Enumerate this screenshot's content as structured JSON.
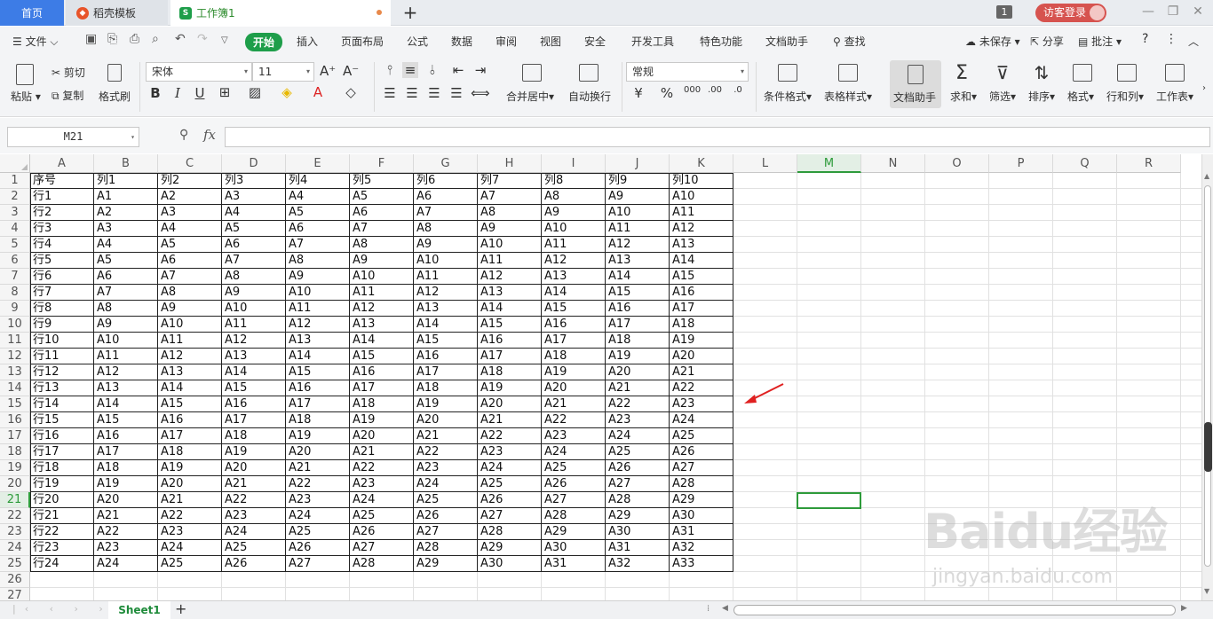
{
  "titlebar": {
    "tabs": [
      {
        "label": "首页"
      },
      {
        "label": "稻壳模板"
      },
      {
        "label": "工作簿1"
      }
    ],
    "new_tab": "+",
    "window_count": "1",
    "login": "访客登录"
  },
  "menubar": {
    "file": "文件",
    "items": [
      "开始",
      "插入",
      "页面布局",
      "公式",
      "数据",
      "审阅",
      "视图",
      "安全",
      "开发工具",
      "特色功能",
      "文档助手"
    ],
    "search": "查找",
    "unsaved": "未保存",
    "share": "分享",
    "comment": "批注"
  },
  "ribbon": {
    "paste": "粘贴",
    "cut": "剪切",
    "copy": "复制",
    "format_painter": "格式刷",
    "font": "宋体",
    "font_size": "11",
    "merge": "合并居中",
    "wrap": "自动换行",
    "number_format": "常规",
    "cond_format": "条件格式",
    "table_style": "表格样式",
    "doc_helper": "文档助手",
    "sum": "求和",
    "filter": "筛选",
    "sort": "排序",
    "format": "格式",
    "rowcol": "行和列",
    "worksheet": "工作表"
  },
  "formula_bar": {
    "name_box": "M21",
    "fx": "fx",
    "formula": ""
  },
  "sheet": {
    "columns": [
      "A",
      "B",
      "C",
      "D",
      "E",
      "F",
      "G",
      "H",
      "I",
      "J",
      "K",
      "L",
      "M",
      "N",
      "O",
      "P",
      "Q",
      "R"
    ],
    "selected_cell": "M21",
    "header_row": [
      "序号",
      "列1",
      "列2",
      "列3",
      "列4",
      "列5",
      "列6",
      "列7",
      "列8",
      "列9",
      "列10"
    ],
    "row_labels": [
      "行1",
      "行2",
      "行3",
      "行4",
      "行5",
      "行6",
      "行7",
      "行8",
      "行9",
      "行10",
      "行11",
      "行12",
      "行13",
      "行14",
      "行15",
      "行16",
      "行17",
      "行18",
      "行19",
      "行20",
      "行21",
      "行22",
      "行23",
      "行24"
    ],
    "row_numbers": [
      "1",
      "2",
      "3",
      "4",
      "5",
      "6",
      "7",
      "8",
      "9",
      "10",
      "11",
      "12",
      "13",
      "14",
      "15",
      "16",
      "17",
      "18",
      "19",
      "20",
      "21",
      "22",
      "23",
      "24",
      "25",
      "26",
      "27"
    ],
    "cells": [
      [
        "A1",
        "A2",
        "A3",
        "A4",
        "A5",
        "A6",
        "A7",
        "A8",
        "A9",
        "A10"
      ],
      [
        "A2",
        "A3",
        "A4",
        "A5",
        "A6",
        "A7",
        "A8",
        "A9",
        "A10",
        "A11"
      ],
      [
        "A3",
        "A4",
        "A5",
        "A6",
        "A7",
        "A8",
        "A9",
        "A10",
        "A11",
        "A12"
      ],
      [
        "A4",
        "A5",
        "A6",
        "A7",
        "A8",
        "A9",
        "A10",
        "A11",
        "A12",
        "A13"
      ],
      [
        "A5",
        "A6",
        "A7",
        "A8",
        "A9",
        "A10",
        "A11",
        "A12",
        "A13",
        "A14"
      ],
      [
        "A6",
        "A7",
        "A8",
        "A9",
        "A10",
        "A11",
        "A12",
        "A13",
        "A14",
        "A15"
      ],
      [
        "A7",
        "A8",
        "A9",
        "A10",
        "A11",
        "A12",
        "A13",
        "A14",
        "A15",
        "A16"
      ],
      [
        "A8",
        "A9",
        "A10",
        "A11",
        "A12",
        "A13",
        "A14",
        "A15",
        "A16",
        "A17"
      ],
      [
        "A9",
        "A10",
        "A11",
        "A12",
        "A13",
        "A14",
        "A15",
        "A16",
        "A17",
        "A18"
      ],
      [
        "A10",
        "A11",
        "A12",
        "A13",
        "A14",
        "A15",
        "A16",
        "A17",
        "A18",
        "A19"
      ],
      [
        "A11",
        "A12",
        "A13",
        "A14",
        "A15",
        "A16",
        "A17",
        "A18",
        "A19",
        "A20"
      ],
      [
        "A12",
        "A13",
        "A14",
        "A15",
        "A16",
        "A17",
        "A18",
        "A19",
        "A20",
        "A21"
      ],
      [
        "A13",
        "A14",
        "A15",
        "A16",
        "A17",
        "A18",
        "A19",
        "A20",
        "A21",
        "A22"
      ],
      [
        "A14",
        "A15",
        "A16",
        "A17",
        "A18",
        "A19",
        "A20",
        "A21",
        "A22",
        "A23"
      ],
      [
        "A15",
        "A16",
        "A17",
        "A18",
        "A19",
        "A20",
        "A21",
        "A22",
        "A23",
        "A24"
      ],
      [
        "A16",
        "A17",
        "A18",
        "A19",
        "A20",
        "A21",
        "A22",
        "A23",
        "A24",
        "A25"
      ],
      [
        "A17",
        "A18",
        "A19",
        "A20",
        "A21",
        "A22",
        "A23",
        "A24",
        "A25",
        "A26"
      ],
      [
        "A18",
        "A19",
        "A20",
        "A21",
        "A22",
        "A23",
        "A24",
        "A25",
        "A26",
        "A27"
      ],
      [
        "A19",
        "A20",
        "A21",
        "A22",
        "A23",
        "A24",
        "A25",
        "A26",
        "A27",
        "A28"
      ],
      [
        "A20",
        "A21",
        "A22",
        "A23",
        "A24",
        "A25",
        "A26",
        "A27",
        "A28",
        "A29"
      ],
      [
        "A21",
        "A22",
        "A23",
        "A24",
        "A25",
        "A26",
        "A27",
        "A28",
        "A29",
        "A30"
      ],
      [
        "A22",
        "A23",
        "A24",
        "A25",
        "A26",
        "A27",
        "A28",
        "A29",
        "A30",
        "A31"
      ],
      [
        "A23",
        "A24",
        "A25",
        "A26",
        "A27",
        "A28",
        "A29",
        "A30",
        "A31",
        "A32"
      ],
      [
        "A24",
        "A25",
        "A26",
        "A27",
        "A28",
        "A29",
        "A30",
        "A31",
        "A32",
        "A33"
      ]
    ]
  },
  "sheetbar": {
    "sheet_tab": "Sheet1",
    "add_sheet": "+"
  },
  "watermark": {
    "text": "Baidu经验",
    "url": "jingyan.baidu.com"
  },
  "colors": {
    "accent_green": "#1e9e4a",
    "selection_green": "#2e9b3b",
    "annotation_red": "#e02020",
    "home_tab_blue": "#3d7ce6"
  }
}
